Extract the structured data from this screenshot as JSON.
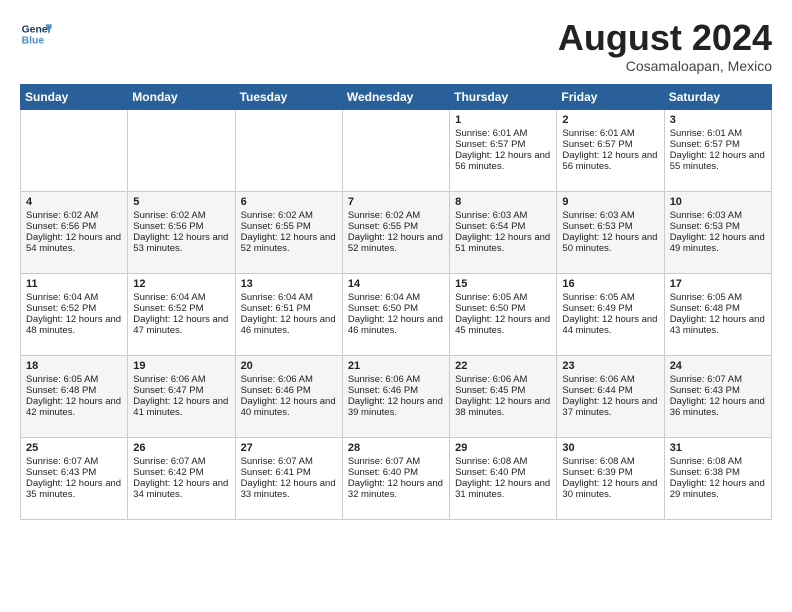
{
  "header": {
    "logo_line1": "General",
    "logo_line2": "Blue",
    "month_title": "August 2024",
    "location": "Cosamaloapan, Mexico"
  },
  "weekdays": [
    "Sunday",
    "Monday",
    "Tuesday",
    "Wednesday",
    "Thursday",
    "Friday",
    "Saturday"
  ],
  "weeks": [
    [
      {
        "day": "",
        "sunrise": "",
        "sunset": "",
        "daylight": ""
      },
      {
        "day": "",
        "sunrise": "",
        "sunset": "",
        "daylight": ""
      },
      {
        "day": "",
        "sunrise": "",
        "sunset": "",
        "daylight": ""
      },
      {
        "day": "",
        "sunrise": "",
        "sunset": "",
        "daylight": ""
      },
      {
        "day": "1",
        "sunrise": "Sunrise: 6:01 AM",
        "sunset": "Sunset: 6:57 PM",
        "daylight": "Daylight: 12 hours and 56 minutes."
      },
      {
        "day": "2",
        "sunrise": "Sunrise: 6:01 AM",
        "sunset": "Sunset: 6:57 PM",
        "daylight": "Daylight: 12 hours and 56 minutes."
      },
      {
        "day": "3",
        "sunrise": "Sunrise: 6:01 AM",
        "sunset": "Sunset: 6:57 PM",
        "daylight": "Daylight: 12 hours and 55 minutes."
      }
    ],
    [
      {
        "day": "4",
        "sunrise": "Sunrise: 6:02 AM",
        "sunset": "Sunset: 6:56 PM",
        "daylight": "Daylight: 12 hours and 54 minutes."
      },
      {
        "day": "5",
        "sunrise": "Sunrise: 6:02 AM",
        "sunset": "Sunset: 6:56 PM",
        "daylight": "Daylight: 12 hours and 53 minutes."
      },
      {
        "day": "6",
        "sunrise": "Sunrise: 6:02 AM",
        "sunset": "Sunset: 6:55 PM",
        "daylight": "Daylight: 12 hours and 52 minutes."
      },
      {
        "day": "7",
        "sunrise": "Sunrise: 6:02 AM",
        "sunset": "Sunset: 6:55 PM",
        "daylight": "Daylight: 12 hours and 52 minutes."
      },
      {
        "day": "8",
        "sunrise": "Sunrise: 6:03 AM",
        "sunset": "Sunset: 6:54 PM",
        "daylight": "Daylight: 12 hours and 51 minutes."
      },
      {
        "day": "9",
        "sunrise": "Sunrise: 6:03 AM",
        "sunset": "Sunset: 6:53 PM",
        "daylight": "Daylight: 12 hours and 50 minutes."
      },
      {
        "day": "10",
        "sunrise": "Sunrise: 6:03 AM",
        "sunset": "Sunset: 6:53 PM",
        "daylight": "Daylight: 12 hours and 49 minutes."
      }
    ],
    [
      {
        "day": "11",
        "sunrise": "Sunrise: 6:04 AM",
        "sunset": "Sunset: 6:52 PM",
        "daylight": "Daylight: 12 hours and 48 minutes."
      },
      {
        "day": "12",
        "sunrise": "Sunrise: 6:04 AM",
        "sunset": "Sunset: 6:52 PM",
        "daylight": "Daylight: 12 hours and 47 minutes."
      },
      {
        "day": "13",
        "sunrise": "Sunrise: 6:04 AM",
        "sunset": "Sunset: 6:51 PM",
        "daylight": "Daylight: 12 hours and 46 minutes."
      },
      {
        "day": "14",
        "sunrise": "Sunrise: 6:04 AM",
        "sunset": "Sunset: 6:50 PM",
        "daylight": "Daylight: 12 hours and 46 minutes."
      },
      {
        "day": "15",
        "sunrise": "Sunrise: 6:05 AM",
        "sunset": "Sunset: 6:50 PM",
        "daylight": "Daylight: 12 hours and 45 minutes."
      },
      {
        "day": "16",
        "sunrise": "Sunrise: 6:05 AM",
        "sunset": "Sunset: 6:49 PM",
        "daylight": "Daylight: 12 hours and 44 minutes."
      },
      {
        "day": "17",
        "sunrise": "Sunrise: 6:05 AM",
        "sunset": "Sunset: 6:48 PM",
        "daylight": "Daylight: 12 hours and 43 minutes."
      }
    ],
    [
      {
        "day": "18",
        "sunrise": "Sunrise: 6:05 AM",
        "sunset": "Sunset: 6:48 PM",
        "daylight": "Daylight: 12 hours and 42 minutes."
      },
      {
        "day": "19",
        "sunrise": "Sunrise: 6:06 AM",
        "sunset": "Sunset: 6:47 PM",
        "daylight": "Daylight: 12 hours and 41 minutes."
      },
      {
        "day": "20",
        "sunrise": "Sunrise: 6:06 AM",
        "sunset": "Sunset: 6:46 PM",
        "daylight": "Daylight: 12 hours and 40 minutes."
      },
      {
        "day": "21",
        "sunrise": "Sunrise: 6:06 AM",
        "sunset": "Sunset: 6:46 PM",
        "daylight": "Daylight: 12 hours and 39 minutes."
      },
      {
        "day": "22",
        "sunrise": "Sunrise: 6:06 AM",
        "sunset": "Sunset: 6:45 PM",
        "daylight": "Daylight: 12 hours and 38 minutes."
      },
      {
        "day": "23",
        "sunrise": "Sunrise: 6:06 AM",
        "sunset": "Sunset: 6:44 PM",
        "daylight": "Daylight: 12 hours and 37 minutes."
      },
      {
        "day": "24",
        "sunrise": "Sunrise: 6:07 AM",
        "sunset": "Sunset: 6:43 PM",
        "daylight": "Daylight: 12 hours and 36 minutes."
      }
    ],
    [
      {
        "day": "25",
        "sunrise": "Sunrise: 6:07 AM",
        "sunset": "Sunset: 6:43 PM",
        "daylight": "Daylight: 12 hours and 35 minutes."
      },
      {
        "day": "26",
        "sunrise": "Sunrise: 6:07 AM",
        "sunset": "Sunset: 6:42 PM",
        "daylight": "Daylight: 12 hours and 34 minutes."
      },
      {
        "day": "27",
        "sunrise": "Sunrise: 6:07 AM",
        "sunset": "Sunset: 6:41 PM",
        "daylight": "Daylight: 12 hours and 33 minutes."
      },
      {
        "day": "28",
        "sunrise": "Sunrise: 6:07 AM",
        "sunset": "Sunset: 6:40 PM",
        "daylight": "Daylight: 12 hours and 32 minutes."
      },
      {
        "day": "29",
        "sunrise": "Sunrise: 6:08 AM",
        "sunset": "Sunset: 6:40 PM",
        "daylight": "Daylight: 12 hours and 31 minutes."
      },
      {
        "day": "30",
        "sunrise": "Sunrise: 6:08 AM",
        "sunset": "Sunset: 6:39 PM",
        "daylight": "Daylight: 12 hours and 30 minutes."
      },
      {
        "day": "31",
        "sunrise": "Sunrise: 6:08 AM",
        "sunset": "Sunset: 6:38 PM",
        "daylight": "Daylight: 12 hours and 29 minutes."
      }
    ]
  ]
}
